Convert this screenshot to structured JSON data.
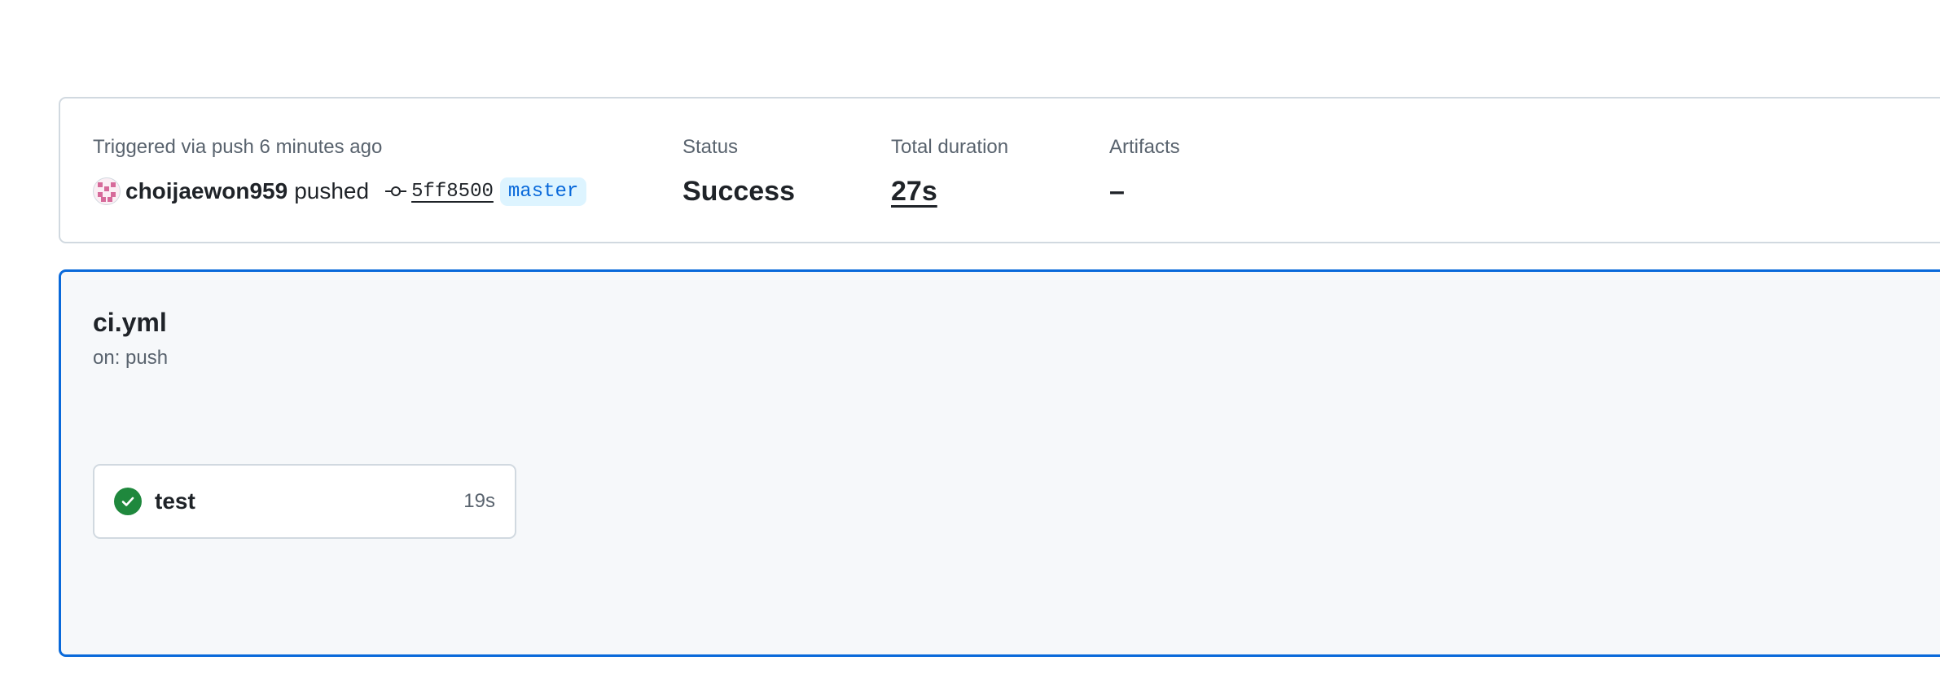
{
  "summary": {
    "trigger_label": "Triggered via push 6 minutes ago",
    "actor": "choijaewon959",
    "action": "pushed",
    "commit_sha": "5ff8500",
    "branch": "master",
    "status_label": "Status",
    "status_value": "Success",
    "duration_label": "Total duration",
    "duration_value": "27s",
    "artifacts_label": "Artifacts",
    "artifacts_value": "–"
  },
  "workflow": {
    "file": "ci.yml",
    "trigger": "on: push",
    "jobs": [
      {
        "name": "test",
        "duration": "19s",
        "status": "success",
        "icon": "check-circle-icon"
      }
    ]
  },
  "colors": {
    "accent": "#0969da",
    "success": "#1f883d",
    "border": "#d1d9e0",
    "canvas": "#f6f8fa",
    "muted_text": "#59636e"
  }
}
